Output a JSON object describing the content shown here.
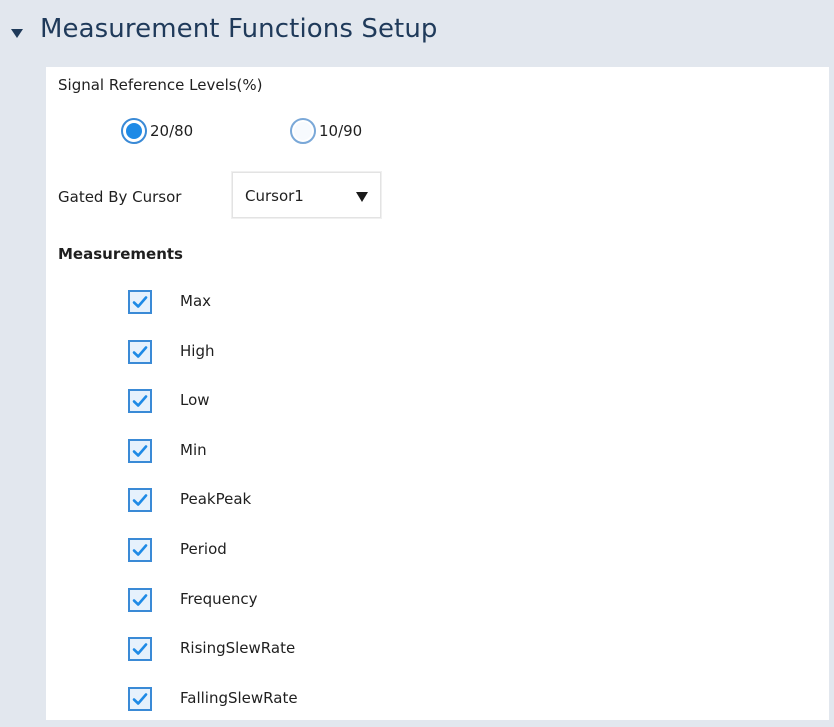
{
  "section": {
    "title": "Measurement Functions Setup",
    "expanded_icon": "triangle-down-icon"
  },
  "signal_reference": {
    "label": "Signal Reference Levels(%)",
    "options": [
      {
        "label": "20/80",
        "selected": true
      },
      {
        "label": "10/90",
        "selected": false
      }
    ]
  },
  "gated_by_cursor": {
    "label": "Gated By Cursor",
    "value": "Cursor1",
    "arrow_icon": "dropdown-arrow-icon"
  },
  "measurements": {
    "heading": "Measurements",
    "items": [
      {
        "label": "Max",
        "checked": true
      },
      {
        "label": "High",
        "checked": true
      },
      {
        "label": "Low",
        "checked": true
      },
      {
        "label": "Min",
        "checked": true
      },
      {
        "label": "PeakPeak",
        "checked": true
      },
      {
        "label": "Period",
        "checked": true
      },
      {
        "label": "Frequency",
        "checked": true
      },
      {
        "label": "RisingSlewRate",
        "checked": true
      },
      {
        "label": "FallingSlewRate",
        "checked": true
      }
    ]
  },
  "colors": {
    "header_background": "#e2e7ee",
    "panel_background": "#ffffff",
    "accent_blue": "#1e8ae6",
    "title_text": "#1f3a5a"
  }
}
